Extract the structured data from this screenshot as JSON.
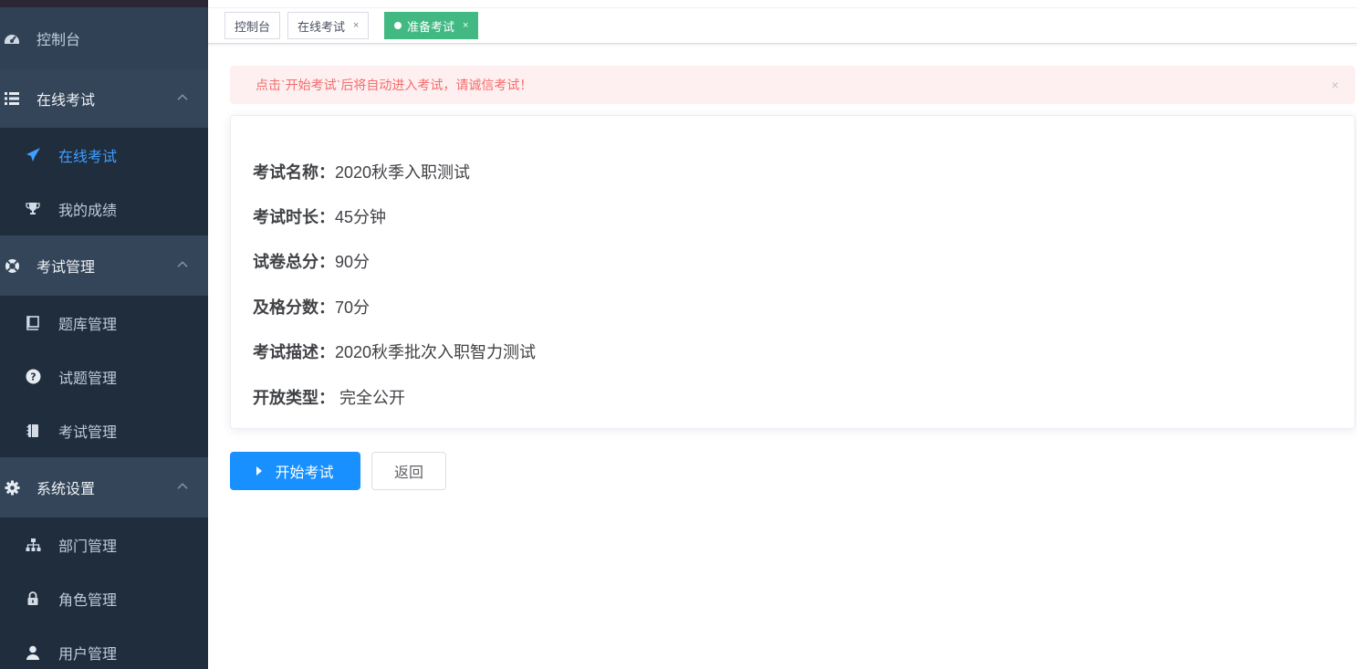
{
  "sidebar": {
    "dashboard": "控制台",
    "groups": [
      {
        "label": "在线考试",
        "items": [
          "在线考试",
          "我的成绩"
        ]
      },
      {
        "label": "考试管理",
        "items": [
          "题库管理",
          "试题管理",
          "考试管理"
        ]
      },
      {
        "label": "系统设置",
        "items": [
          "部门管理",
          "角色管理",
          "用户管理"
        ]
      }
    ],
    "active_item": "在线考试",
    "active_color": "#409eff"
  },
  "tags": [
    {
      "label": "控制台",
      "closable": false,
      "active": false
    },
    {
      "label": "在线考试",
      "closable": true,
      "active": false
    },
    {
      "label": "准备考试",
      "closable": true,
      "active": true
    }
  ],
  "tag_close_glyph": "×",
  "alert": {
    "text": "点击`开始考试`后将自动进入考试，请诚信考试！",
    "close_glyph": "×"
  },
  "exam": [
    {
      "label": "考试名称：",
      "value": "2020秋季入职测试"
    },
    {
      "label": "考试时长：",
      "value": "45分钟"
    },
    {
      "label": "试卷总分：",
      "value": "90分"
    },
    {
      "label": "及格分数：",
      "value": "70分"
    },
    {
      "label": "考试描述：",
      "value": "2020秋季批次入职智力测试"
    },
    {
      "label": "开放类型：",
      "value": " 完全公开"
    }
  ],
  "buttons": {
    "start": "开始考试",
    "back": "返回"
  },
  "colors": {
    "sidebar_bg": "#304156",
    "tag_active": "#42b983",
    "primary": "#1890ff",
    "alert_text": "#f56c6c"
  },
  "icons": {
    "dashboard": "dashboard-icon",
    "online_exam_group": "list-icon",
    "online_exam": "paper-plane-icon",
    "my_results": "trophy-icon",
    "exam_manage_group": "life-ring-icon",
    "repo_manage": "book-icon",
    "question_manage": "question-circle-icon",
    "exam_manage": "notebook-icon",
    "system_group": "gear-icon",
    "dept_manage": "sitemap-icon",
    "role_manage": "lock-icon",
    "user_manage": "user-icon"
  }
}
